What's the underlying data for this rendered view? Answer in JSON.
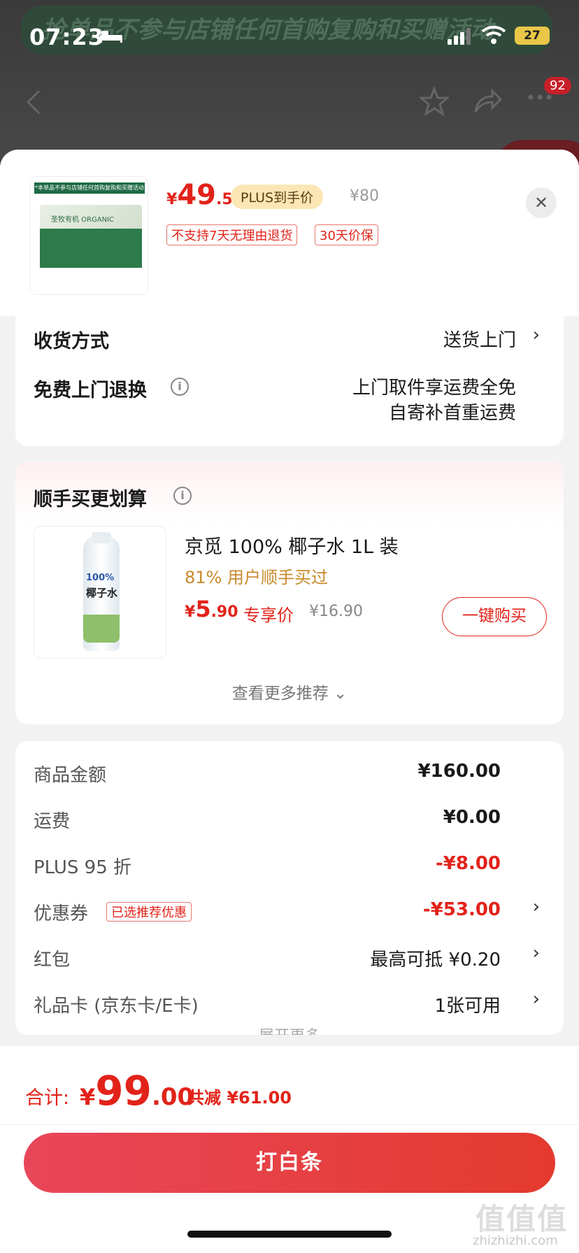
{
  "status_bar": {
    "time": "07:23",
    "battery": "27"
  },
  "background_page": {
    "banner_text": "抢单品不参与店铺任何首购复购和买赠活动",
    "nav_badge": "92"
  },
  "product": {
    "thumbnail_banner": "*本单品不参与店铺任何首购复购和买赠活动",
    "thumbnail_brand": "圣牧有机 ORGANIC",
    "price_symbol": "¥",
    "price_int": "49",
    "price_dec": ".5",
    "plus_tag": "PLUS到手价",
    "original_price": "¥80",
    "tags": [
      "不支持7天无理由退货",
      "30天价保"
    ]
  },
  "delivery": {
    "method_label": "收货方式",
    "method_value": "送货上门",
    "return_label": "免费上门退换",
    "return_value_line1": "上门取件享运费全免",
    "return_value_line2": "自寄补首重运费"
  },
  "addon": {
    "title": "顺手买更划算",
    "item_name": "京觅 100% 椰子水 1L 装",
    "item_sub": "81% 用户顺手买过",
    "bottle_text1": "100%",
    "bottle_text2": "椰子水",
    "price_symbol": "¥",
    "price_int": "5",
    "price_dec": ".90",
    "exclusive_label": "专享价",
    "original_price": "¥16.90",
    "buy_button": "一键购买",
    "more_label": "查看更多推荐 ⌄"
  },
  "fees": {
    "rows": [
      {
        "label": "商品金额",
        "value": "¥160.00"
      },
      {
        "label": "运费",
        "value": "¥0.00"
      },
      {
        "label": "PLUS 95 折",
        "value": "-¥8.00"
      },
      {
        "label": "优惠券",
        "value": "-¥53.00",
        "tag": "已选推荐优惠"
      },
      {
        "label": "红包",
        "value": "最高可抵 ¥0.20"
      },
      {
        "label": "礼品卡 (京东卡/E卡)",
        "value": "1张可用"
      }
    ],
    "fade_more": "展开更多"
  },
  "checkout": {
    "total_label": "合计:",
    "total_symbol": "¥",
    "total_int": "99",
    "total_dec": ".00",
    "saving": "共减 ¥61.00",
    "pay_button": "打白条"
  },
  "watermark": {
    "main": "值值值",
    "sub": "zhizhizhi.com"
  },
  "colors": {
    "accent_red": "#e2231a",
    "plus_gold": "#fbe6b4",
    "sub_gold": "#c88a2c"
  }
}
